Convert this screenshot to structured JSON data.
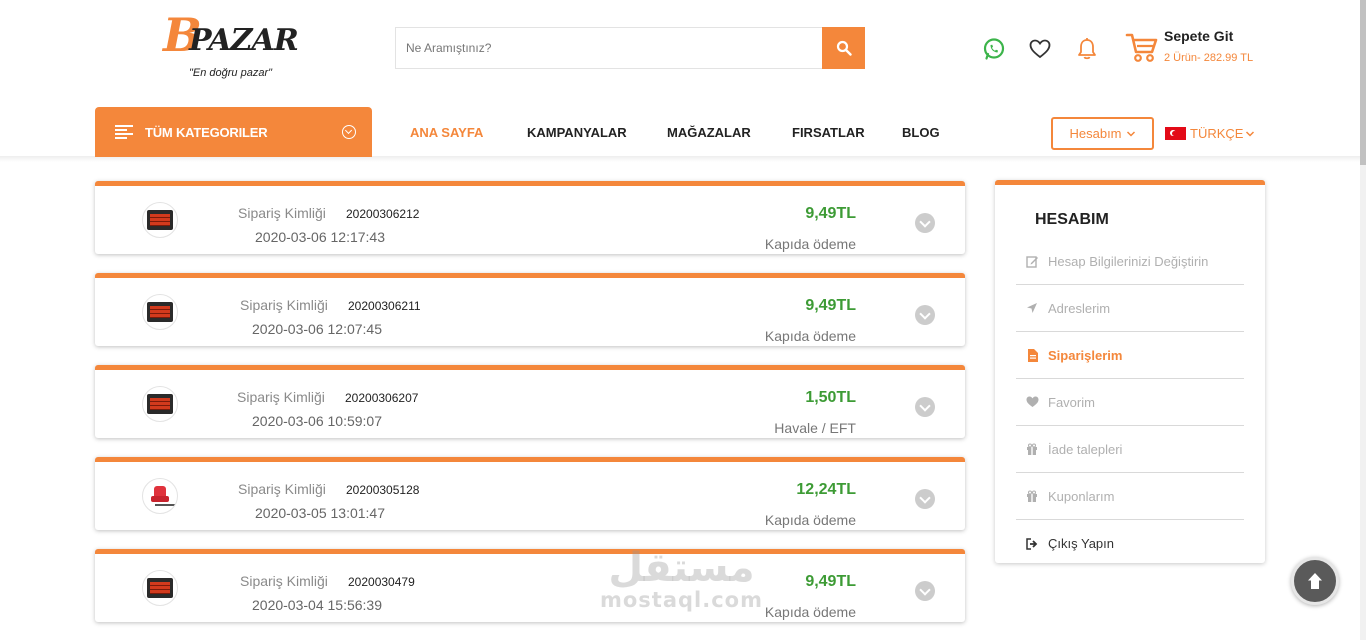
{
  "brand": {
    "logo_initial": "B",
    "logo_text": "PAZAR",
    "tagline": "\"En doğru pazar\"",
    "accent_color": "#f4873b"
  },
  "search": {
    "placeholder": "Ne Aramıştınız?",
    "icon": "search-icon"
  },
  "header_icons": [
    "whatsapp-icon",
    "heart-icon",
    "bell-icon",
    "cart-icon"
  ],
  "cart": {
    "title": "Sepete Git",
    "summary": "2 Ürün- 282.99 TL"
  },
  "nav": {
    "all_categories": "TÜM KATEGORILER",
    "links": [
      "ANA SAYFA",
      "KAMPANYALAR",
      "MAĞAZALAR",
      "FIRSATLAR",
      "BLOG"
    ],
    "active_index": 0,
    "account": "Hesabım",
    "language": "TÜRKÇE"
  },
  "orders": [
    {
      "label": "Sipariş Kimliği",
      "id": "20200306212",
      "date": "2020-03-06 12:17:43",
      "price": "9,49TL",
      "payment": "Kapıda ödeme",
      "product_icon": "heater-icon"
    },
    {
      "label": "Sipariş Kimliği",
      "id": "20200306211",
      "date": "2020-03-06 12:07:45",
      "price": "9,49TL",
      "payment": "Kapıda ödeme",
      "product_icon": "heater-icon"
    },
    {
      "label": "Sipariş Kimliği",
      "id": "20200306207",
      "date": "2020-03-06 10:59:07",
      "price": "1,50TL",
      "payment": "Havale / EFT",
      "product_icon": "heater-icon"
    },
    {
      "label": "Sipariş Kimliği",
      "id": "20200305128",
      "date": "2020-03-05 13:01:47",
      "price": "12,24TL",
      "payment": "Kapıda ödeme",
      "product_icon": "chair-icon"
    },
    {
      "label": "Sipariş Kimliği",
      "id": "2020030479",
      "date": "2020-03-04 15:56:39",
      "price": "9,49TL",
      "payment": "Kapıda ödeme",
      "product_icon": "heater-icon"
    }
  ],
  "sidebar": {
    "title": "HESABIM",
    "items": [
      {
        "label": "Hesap Bilgilerinizi Değiştirin",
        "icon": "edit-icon"
      },
      {
        "label": "Adreslerim",
        "icon": "location-arrow-icon"
      },
      {
        "label": "Siparişlerim",
        "icon": "document-icon"
      },
      {
        "label": "Favorim",
        "icon": "heart-icon"
      },
      {
        "label": "İade talepleri",
        "icon": "gift-icon"
      },
      {
        "label": "Kuponlarım",
        "icon": "gift-icon"
      },
      {
        "label": "Çıkış Yapın",
        "icon": "sign-out-icon"
      }
    ],
    "active_index": 2
  },
  "watermark": {
    "arabic": "مستقل",
    "latin": "mostaql.com"
  }
}
